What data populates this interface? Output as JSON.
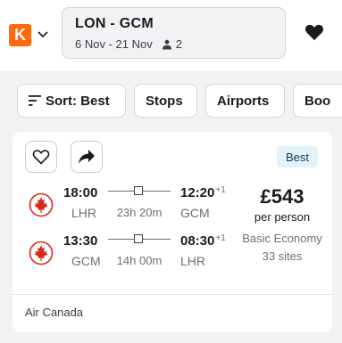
{
  "header": {
    "logo_letter": "K",
    "route": "LON - GCM",
    "dates": "6 Nov - 21 Nov",
    "travellers": "2",
    "icons": {
      "logo_menu": "chevron-down-icon",
      "save": "heart-icon",
      "travellers": "person-icon"
    }
  },
  "filters": {
    "sort_label": "Sort: Best",
    "items": [
      "Stops",
      "Airports",
      "Boo"
    ]
  },
  "result": {
    "badge": "Best",
    "price": "£543",
    "price_note": "per person",
    "cabin": "Basic Economy",
    "sites": "33 sites",
    "airline": "Air Canada",
    "legs": [
      {
        "dep_time": "18:00",
        "dep_code": "LHR",
        "duration": "23h 20m",
        "arr_time": "12:20",
        "day_offset": "+1",
        "arr_code": "GCM"
      },
      {
        "dep_time": "13:30",
        "dep_code": "GCM",
        "duration": "14h 00m",
        "arr_time": "08:30",
        "day_offset": "+1",
        "arr_code": "LHR"
      }
    ]
  },
  "colors": {
    "brand": "#ff690f",
    "badge_bg": "#e4f2fb",
    "airline_red": "#d52b1e",
    "background": "#f1f2f4"
  }
}
